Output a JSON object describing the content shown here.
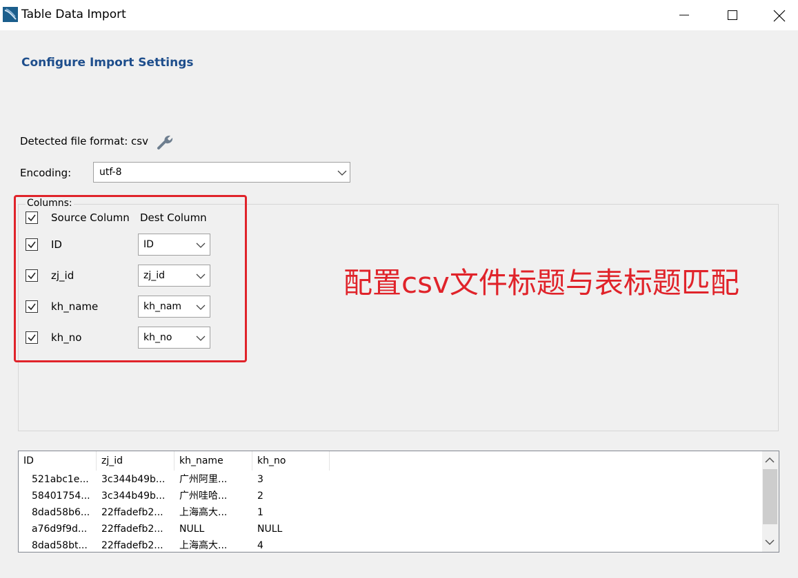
{
  "window": {
    "title": "Table Data Import"
  },
  "heading": "Configure Import Settings",
  "format": {
    "label": "Detected file format: csv"
  },
  "encoding": {
    "label": "Encoding:",
    "value": "utf-8"
  },
  "columns": {
    "group_label": "Columns:",
    "source_header": "Source Column",
    "dest_header": "Dest Column",
    "rows": [
      {
        "source": "ID",
        "dest": "ID",
        "checked": true
      },
      {
        "source": "zj_id",
        "dest": "zj_id",
        "checked": true
      },
      {
        "source": "kh_name",
        "dest": "kh_nam",
        "checked": true
      },
      {
        "source": "kh_no",
        "dest": "kh_no",
        "checked": true
      }
    ]
  },
  "annotation": {
    "text": "配置csv文件标题与表标题匹配",
    "color": "#e0232a"
  },
  "preview": {
    "headers": [
      "ID",
      "zj_id",
      "kh_name",
      "kh_no"
    ],
    "rows": [
      [
        "521abc1e...",
        "3c344b49b...",
        "广州阿里...",
        "3"
      ],
      [
        "58401754...",
        "3c344b49b...",
        "广州哇哈...",
        "2"
      ],
      [
        "8dad58b6...",
        "22ffadefb2...",
        "上海高大...",
        "1"
      ],
      [
        "a76d9f9d...",
        "22ffadefb2...",
        "NULL",
        "NULL"
      ],
      [
        "8dad58bt...",
        "22ffadefb2...",
        "上海高大...",
        "4"
      ]
    ]
  },
  "colors": {
    "heading": "#1e4e8c",
    "annotation": "#e0232a"
  }
}
